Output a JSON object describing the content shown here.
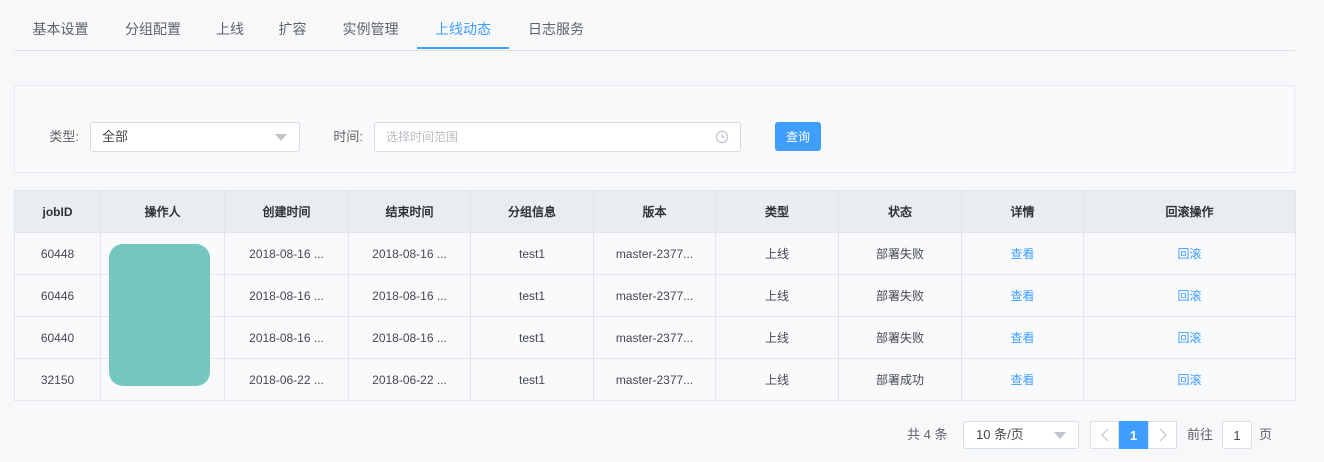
{
  "tabs": [
    {
      "label": "基本设置",
      "active": false
    },
    {
      "label": "分组配置",
      "active": false
    },
    {
      "label": "上线",
      "active": false
    },
    {
      "label": "扩容",
      "active": false
    },
    {
      "label": "实例管理",
      "active": false
    },
    {
      "label": "上线动态",
      "active": true
    },
    {
      "label": "日志服务",
      "active": false
    }
  ],
  "filter": {
    "type_label": "类型:",
    "type_value": "全部",
    "time_label": "时间:",
    "time_placeholder": "选择时间范围",
    "query_label": "查询"
  },
  "table": {
    "columns": [
      "jobID",
      "操作人",
      "创建时间",
      "结束时间",
      "分组信息",
      "版本",
      "类型",
      "状态",
      "详情",
      "回滚操作"
    ],
    "rows": [
      {
        "job_id": "60448",
        "created": "2018-08-16 ...",
        "ended": "2018-08-16 ...",
        "group": "test1",
        "version": "master-2377...",
        "type": "上线",
        "status": "部署失败",
        "detail": "查看",
        "rollback": "回滚"
      },
      {
        "job_id": "60446",
        "created": "2018-08-16 ...",
        "ended": "2018-08-16 ...",
        "group": "test1",
        "version": "master-2377...",
        "type": "上线",
        "status": "部署失败",
        "detail": "查看",
        "rollback": "回滚"
      },
      {
        "job_id": "60440",
        "created": "2018-08-16 ...",
        "ended": "2018-08-16 ...",
        "group": "test1",
        "version": "master-2377...",
        "type": "上线",
        "status": "部署失败",
        "detail": "查看",
        "rollback": "回滚"
      },
      {
        "job_id": "32150",
        "created": "2018-06-22 ...",
        "ended": "2018-06-22 ...",
        "group": "test1",
        "version": "master-2377...",
        "type": "上线",
        "status": "部署成功",
        "detail": "查看",
        "rollback": "回滚"
      }
    ]
  },
  "pagination": {
    "total_text": "共 4 条",
    "page_size": "10 条/页",
    "current_page": "1",
    "goto_prefix": "前往",
    "goto_value": "1",
    "goto_suffix": "页"
  },
  "icons": {
    "type_select": "caret-down-icon",
    "time_picker": "clock-icon",
    "page_size_select": "caret-down-icon",
    "prev_page": "chevron-left-icon",
    "next_page": "chevron-right-icon"
  },
  "colors": {
    "accent": "#409eff",
    "redaction": "#74c6bf"
  }
}
